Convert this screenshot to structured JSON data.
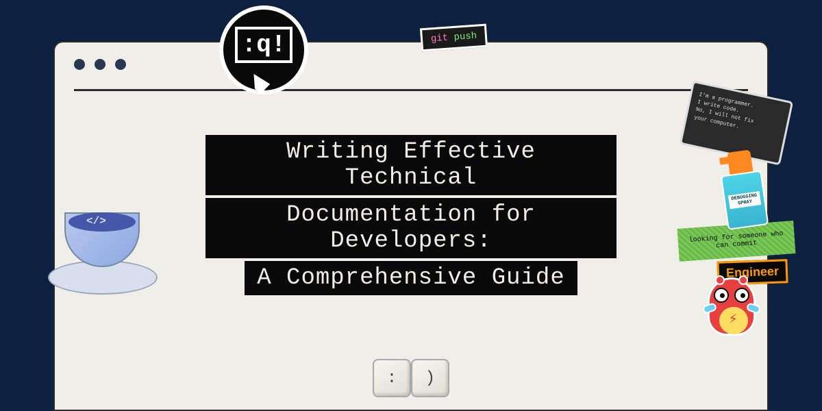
{
  "title": {
    "line1": "Writing Effective Technical",
    "line2": "Documentation for Developers:",
    "line3": "A Comprehensive Guide"
  },
  "stickers": {
    "vim_quit": ":q!",
    "git_push_git": "git",
    "git_push_push": " push",
    "teacup_code": "</>",
    "key_colon": ":",
    "key_paren": ")",
    "programmer_line1": "I'm a programmer.",
    "programmer_line2": "I write code.",
    "programmer_line3": "No, I will not fix",
    "programmer_line4": "your computer.",
    "spray_label1": "DEBUGGING",
    "spray_label2": "SPRAY",
    "commit_text": "looking for someone who can commit",
    "engineer_text": "Engineer"
  }
}
